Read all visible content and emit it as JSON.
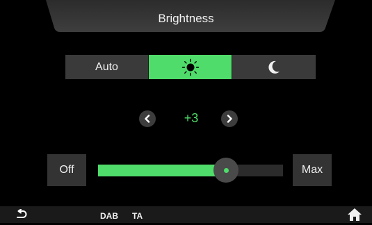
{
  "header": {
    "title": "Brightness"
  },
  "modes": [
    {
      "label": "Auto",
      "active": false
    },
    {
      "icon": "sun-icon",
      "active": true
    },
    {
      "icon": "moon-icon",
      "active": false
    }
  ],
  "level": {
    "value": "+3",
    "fraction": 0.69
  },
  "slider": {
    "min_label": "Off",
    "max_label": "Max"
  },
  "status_bar": {
    "source": "DAB",
    "traffic": "TA"
  },
  "colors": {
    "accent": "#4fdc6a",
    "button": "#3a3a3a",
    "background": "#000000"
  }
}
